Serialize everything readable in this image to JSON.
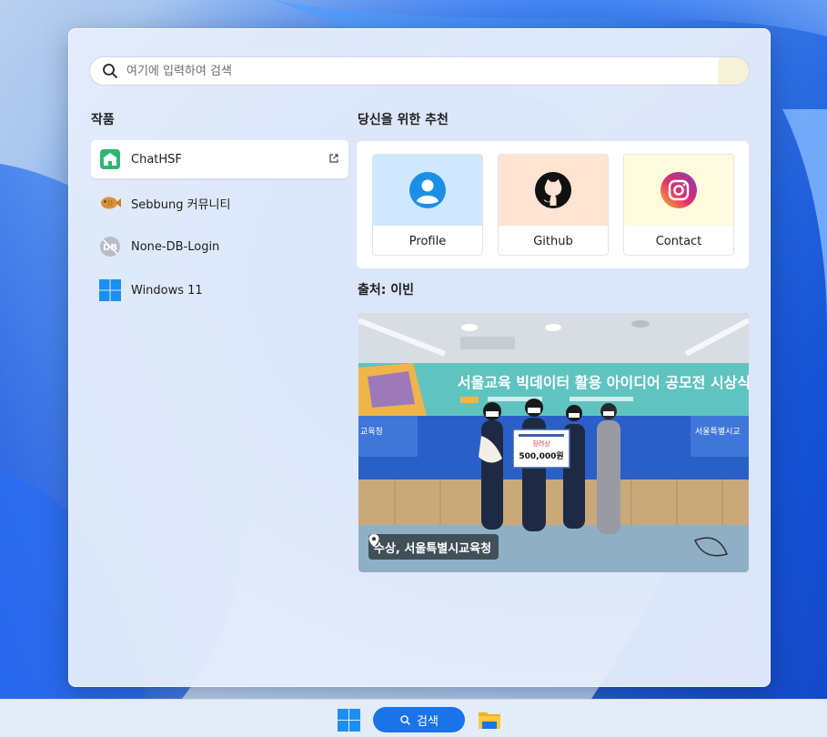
{
  "search": {
    "placeholder": "여기에 입력하여 검색"
  },
  "works": {
    "title": "작품",
    "items": [
      {
        "label": "ChatHSF",
        "icon": "chathsf-icon",
        "active": true
      },
      {
        "label": "Sebbung 커뮤니티",
        "icon": "fish-bread-icon"
      },
      {
        "label": "None-DB-Login",
        "icon": "db-icon"
      },
      {
        "label": "Windows 11",
        "icon": "windows-icon"
      }
    ]
  },
  "recommend": {
    "title": "당신을 위한 추천",
    "cards": [
      {
        "label": "Profile",
        "icon": "profile-icon",
        "bg": "#cfe8ff"
      },
      {
        "label": "Github",
        "icon": "github-icon",
        "bg": "#ffe4d4"
      },
      {
        "label": "Contact",
        "icon": "instagram-icon",
        "bg": "#fffbdc"
      }
    ]
  },
  "source": {
    "title": "출처: 이빈",
    "banner_text": "서울교육 빅데이터 활용 아이디어 공모전 시상식",
    "left_sign": "교육청",
    "right_sign": "서울특별시교",
    "prize_label": "장려상",
    "prize_amount": "500,000원",
    "caption": "수상, 서울특별시교육청"
  },
  "taskbar": {
    "search_label": "검색"
  },
  "colors": {
    "accent": "#1a73e8",
    "chathsf": "#2bb673",
    "instagram": "#e1306c"
  }
}
